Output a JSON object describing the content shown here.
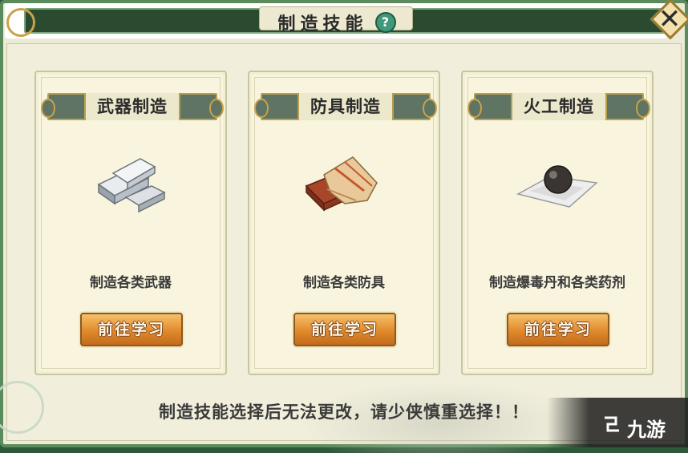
{
  "header": {
    "title": "制造技能",
    "help_glyph": "?"
  },
  "close_button": {
    "glyph": "✕"
  },
  "cards": [
    {
      "title": "武器制造",
      "icon": "silver-ingots-icon",
      "description": "制造各类武器",
      "button": "前往学习"
    },
    {
      "title": "防具制造",
      "icon": "cloth-armor-icon",
      "description": "制造各类防具",
      "button": "前往学习"
    },
    {
      "title": "火工制造",
      "icon": "bomb-pill-icon",
      "description": "制造爆毒丹和各类药剂",
      "button": "前往学习"
    }
  ],
  "footer": {
    "warning": "制造技能选择后无法更改，请少侠慎重选择！！"
  },
  "watermark": {
    "text": "九游"
  },
  "colors": {
    "frame_green": "#2b4b30",
    "button_orange": "#e08a2c",
    "card_bg": "#f8f4de"
  }
}
